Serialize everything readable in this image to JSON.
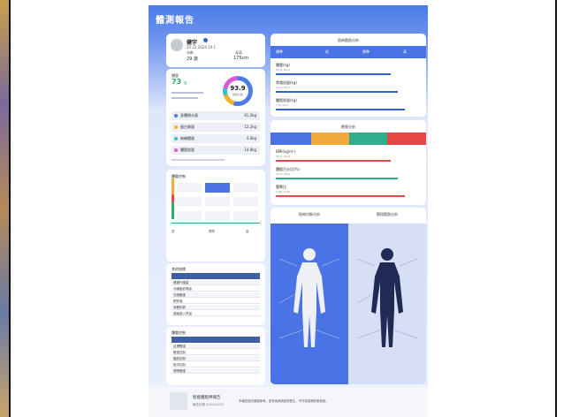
{
  "report": {
    "title": "體測報告",
    "user": {
      "name": "健宇",
      "date": "20 22 2024 10.1",
      "age_label": "年齡",
      "age": "29 歲",
      "height_label": "身高",
      "height": "175cm"
    },
    "weight": {
      "label": "體重",
      "value": "73",
      "unit": "g",
      "score": "93.9",
      "score_label": "健康分數",
      "items": [
        {
          "name": "身體總水量",
          "value": "41.2kg",
          "color": "#4a7ce8"
        },
        {
          "name": "蛋白質量",
          "value": "12.2kg",
          "color": "#f3b02a"
        },
        {
          "name": "無機鹽量",
          "value": "4.0kg",
          "color": "#35c1c8"
        },
        {
          "name": "體脂肪量",
          "value": "14.8kg",
          "color": "#d95ad8"
        }
      ]
    },
    "analysis_title": "體重控制",
    "sections": {
      "muscle_fat": "肌肉脂肪分析",
      "obesity": "肥胖分析",
      "body_balance": "肌肉均衡分析",
      "segment_fat": "節段脂肪分析",
      "standard_labels": {
        "left": "標準",
        "mid": "標準",
        "right": "超標"
      },
      "low_label": "低",
      "standard": "標準",
      "high": "高"
    },
    "rows_muscle": [
      {
        "label": "體重(kg)",
        "range": "55.0~65.0"
      },
      {
        "label": "骨骼肌量(kg)",
        "range": "29.0~35.0"
      },
      {
        "label": "體脂肪量(kg)",
        "range": "7.0~14.0"
      }
    ],
    "rows_obesity": [
      {
        "label": "BMI(kg/m²)",
        "range": "18.5~24.0"
      },
      {
        "label": "體脂百分比(%)",
        "range": "10.0~20.0"
      },
      {
        "label": "腰臀比",
        "range": "0.80~0.90"
      }
    ],
    "other_title": "其他指標",
    "other_rows": [
      "基礎代謝量",
      "內臟脂肪等級",
      "去脂體重",
      "肥胖度",
      "身體年齡",
      "建議攝入熱量"
    ],
    "control_title": "體重控制",
    "control_rows": [
      "目標體重",
      "體重控制",
      "脂肪控制",
      "肌肉控制",
      "理想體重"
    ],
    "footer": {
      "brand": "智能體脂秤報告",
      "sub": "報告日期 2024/10/12",
      "note": "本報告僅供健康參考，如有疾病請諮詢醫生，不作為醫療診斷依據。"
    }
  }
}
